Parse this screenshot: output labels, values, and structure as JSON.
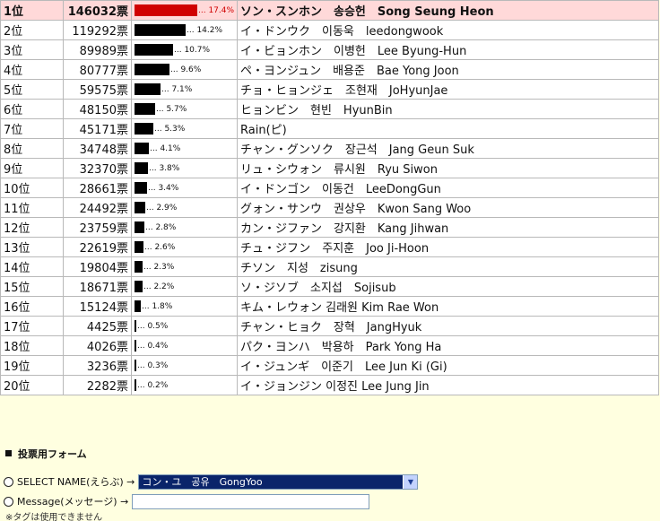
{
  "ranking": {
    "rows": [
      {
        "rank": "1位",
        "votes": "146032票",
        "share": 17.4,
        "pct": "... 17.4%",
        "name": "ソン・スンホン　송승헌　Song Seung Heon",
        "top": true
      },
      {
        "rank": "2位",
        "votes": "119292票",
        "share": 14.2,
        "pct": "... 14.2%",
        "name": "イ・ドンウク　이동욱　leedongwook"
      },
      {
        "rank": "3位",
        "votes": "89989票",
        "share": 10.7,
        "pct": "... 10.7%",
        "name": "イ・ビョンホン　이병헌　Lee Byung-Hun"
      },
      {
        "rank": "4位",
        "votes": "80777票",
        "share": 9.6,
        "pct": "... 9.6%",
        "name": "ペ・ヨンジュン　배용준　Bae Yong Joon"
      },
      {
        "rank": "5位",
        "votes": "59575票",
        "share": 7.1,
        "pct": "... 7.1%",
        "name": "チョ・ヒョンジェ　조현재　JoHyunJae"
      },
      {
        "rank": "6位",
        "votes": "48150票",
        "share": 5.7,
        "pct": "... 5.7%",
        "name": "ヒョンビン　현빈　HyunBin"
      },
      {
        "rank": "7位",
        "votes": "45171票",
        "share": 5.3,
        "pct": "... 5.3%",
        "name": "Rain(ピ)"
      },
      {
        "rank": "8位",
        "votes": "34748票",
        "share": 4.1,
        "pct": "... 4.1%",
        "name": "チャン・グンソク　장근석　Jang Geun Suk"
      },
      {
        "rank": "9位",
        "votes": "32370票",
        "share": 3.8,
        "pct": "... 3.8%",
        "name": "リュ・シウォン　류시원　Ryu Siwon"
      },
      {
        "rank": "10位",
        "votes": "28661票",
        "share": 3.4,
        "pct": "... 3.4%",
        "name": "イ・ドンゴン　이동건　LeeDongGun"
      },
      {
        "rank": "11位",
        "votes": "24492票",
        "share": 2.9,
        "pct": "... 2.9%",
        "name": "グォン・サンウ　권상우　Kwon Sang Woo"
      },
      {
        "rank": "12位",
        "votes": "23759票",
        "share": 2.8,
        "pct": "... 2.8%",
        "name": "カン・ジファン　강지환　Kang Jihwan"
      },
      {
        "rank": "13位",
        "votes": "22619票",
        "share": 2.6,
        "pct": "... 2.6%",
        "name": "チュ・ジフン　주지훈　Joo Ji-Hoon"
      },
      {
        "rank": "14位",
        "votes": "19804票",
        "share": 2.3,
        "pct": "... 2.3%",
        "name": "チソン　지성　zisung"
      },
      {
        "rank": "15位",
        "votes": "18671票",
        "share": 2.2,
        "pct": "... 2.2%",
        "name": "ソ・ジソブ　소지섭　Sojisub"
      },
      {
        "rank": "16位",
        "votes": "15124票",
        "share": 1.8,
        "pct": "... 1.8%",
        "name": "キム・レウォン 김래원 Kim Rae Won"
      },
      {
        "rank": "17位",
        "votes": "4425票",
        "share": 0.5,
        "pct": "... 0.5%",
        "name": "チャン・ヒョク　장혁　JangHyuk"
      },
      {
        "rank": "18位",
        "votes": "4026票",
        "share": 0.4,
        "pct": "... 0.4%",
        "name": "パク・ヨンハ　박용하　Park Yong Ha"
      },
      {
        "rank": "19位",
        "votes": "3236票",
        "share": 0.3,
        "pct": "... 0.3%",
        "name": "イ・ジュンギ　이준기　Lee Jun Ki (Gi)"
      },
      {
        "rank": "20位",
        "votes": "2282票",
        "share": 0.2,
        "pct": "... 0.2%",
        "name": "イ・ジョンジン 이정진 Lee Jung Jin"
      }
    ]
  },
  "form": {
    "heading": "投票用フォーム",
    "select_label": "SELECT NAME(えらぶ) →",
    "select_value": "コン・ユ　공유　GongYoo",
    "message_label": "Message(メッセージ) →",
    "message_value": "",
    "cutoff_note": "※タグは使用できません"
  },
  "colors": {
    "top_row_bg": "#ffd9d9",
    "top_row_text": "#e3120b",
    "top_bar": "#d00000",
    "page_bg": "#ffffe0",
    "select_highlight": "#0a246a"
  },
  "icons": {
    "select_arrow": "chevron-down-icon",
    "heading_marker": "black-square-icon"
  }
}
